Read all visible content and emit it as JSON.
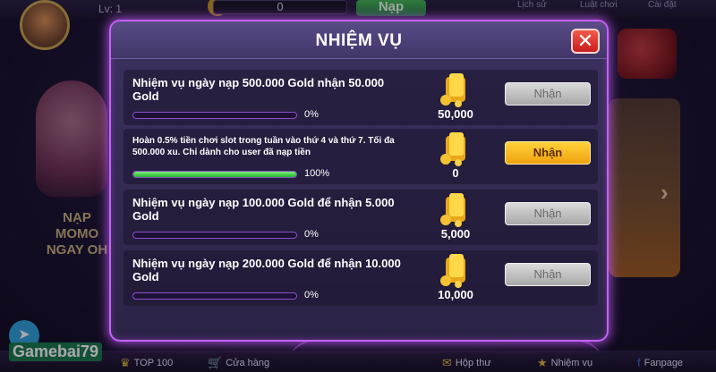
{
  "lobby": {
    "level": "Lv: 1",
    "coin_value": "0",
    "nap_label": "Nạp",
    "top_items": [
      "Lịch sử",
      "Luật chơi",
      "Cài đặt"
    ],
    "promo_text": "NẠP MOMO NGAY OH",
    "brand": "Gamebai79",
    "bottom_nav": [
      {
        "label": "TOP 100",
        "icon": "trophy-icon"
      },
      {
        "label": "Cửa hàng",
        "icon": "cart-icon"
      },
      {
        "label": "Hộp thư",
        "icon": "mail-icon"
      },
      {
        "label": "Nhiệm vụ",
        "icon": "star-icon"
      },
      {
        "label": "Fanpage",
        "icon": "facebook-icon"
      }
    ]
  },
  "modal": {
    "title": "NHIỆM VỤ",
    "close_icon": "close-icon",
    "tasks": [
      {
        "title": "Nhiệm vụ ngày nạp 500.000 Gold nhận 50.000 Gold",
        "progress_pct": 0,
        "progress_text": "0%",
        "reward": "50,000",
        "button": "Nhận",
        "button_state": "disabled"
      },
      {
        "title": "Hoàn 0.5% tiền chơi slot trong tuần vào thứ 4 và thứ 7. Tối đa 500.000 xu. Chỉ dành cho user đã nạp tiền",
        "progress_pct": 100,
        "progress_text": "100%",
        "reward": "0",
        "button": "Nhận",
        "button_state": "active"
      },
      {
        "title": "Nhiệm vụ ngày nạp 100.000 Gold để nhận 5.000 Gold",
        "progress_pct": 0,
        "progress_text": "0%",
        "reward": "5,000",
        "button": "Nhận",
        "button_state": "disabled"
      },
      {
        "title": "Nhiệm vụ ngày nạp 200.000 Gold để nhận 10.000 Gold",
        "progress_pct": 0,
        "progress_text": "0%",
        "reward": "10,000",
        "button": "Nhận",
        "button_state": "disabled"
      }
    ]
  },
  "colors": {
    "modal_border": "#c860ff",
    "active_button": "#f0a20e",
    "progress_fill": "#22b528",
    "close_button": "#c81e1e"
  }
}
